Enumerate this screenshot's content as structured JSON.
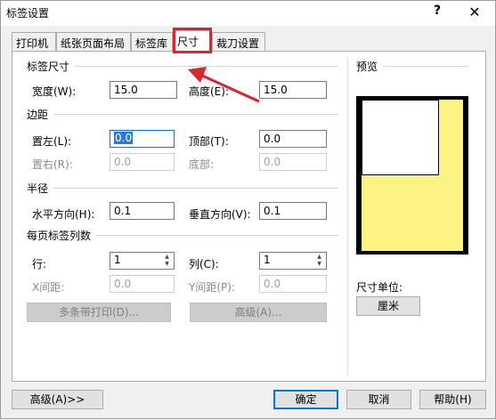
{
  "window": {
    "title": "标签设置",
    "help_symbol": "?",
    "close_symbol": "✕"
  },
  "tabs": [
    {
      "label": "打印机",
      "active": false
    },
    {
      "label": "纸张页面布局",
      "active": false
    },
    {
      "label": "标签库",
      "active": false
    },
    {
      "label": "尺寸",
      "active": true
    },
    {
      "label": "裁刀设置",
      "active": false
    }
  ],
  "label_size": {
    "title": "标签尺寸",
    "width_label": "宽度(W):",
    "width_value": "15.0",
    "height_label": "高度(E):",
    "height_value": "15.0"
  },
  "margins": {
    "title": "边距",
    "left_label": "置左(L):",
    "left_value": "0.0",
    "top_label": "顶部(T):",
    "top_value": "0.0",
    "right_label": "置右(R):",
    "right_value": "0.0",
    "bottom_label": "底部:",
    "bottom_value": "0.0"
  },
  "radius": {
    "title": "半径",
    "horizontal_label": "水平方向(H):",
    "horizontal_value": "0.1",
    "vertical_label": "垂直方向(V):",
    "vertical_value": "0.1"
  },
  "columns": {
    "title": "每页标签列数",
    "rows_label": "行:",
    "rows_value": "1",
    "cols_label": "列(C):",
    "cols_value": "1",
    "x_gap_label": "X间距:",
    "x_gap_value": "0.0",
    "y_gap_label": "Y间距(P):",
    "y_gap_value": "0.0",
    "multi_strip_button": "多条带打印(D)...",
    "advanced_inner_button": "高级(A)..."
  },
  "preview": {
    "title": "预览",
    "unit_label": "尺寸单位:",
    "unit_button": "厘米"
  },
  "footer": {
    "advanced_button": "高级(A)>>",
    "ok_button": "确定",
    "cancel_button": "取消",
    "help_button": "帮助(H)"
  },
  "colors": {
    "highlight": "#d8262a",
    "preview_paper": "#fbf483",
    "focus": "#0078d7"
  }
}
